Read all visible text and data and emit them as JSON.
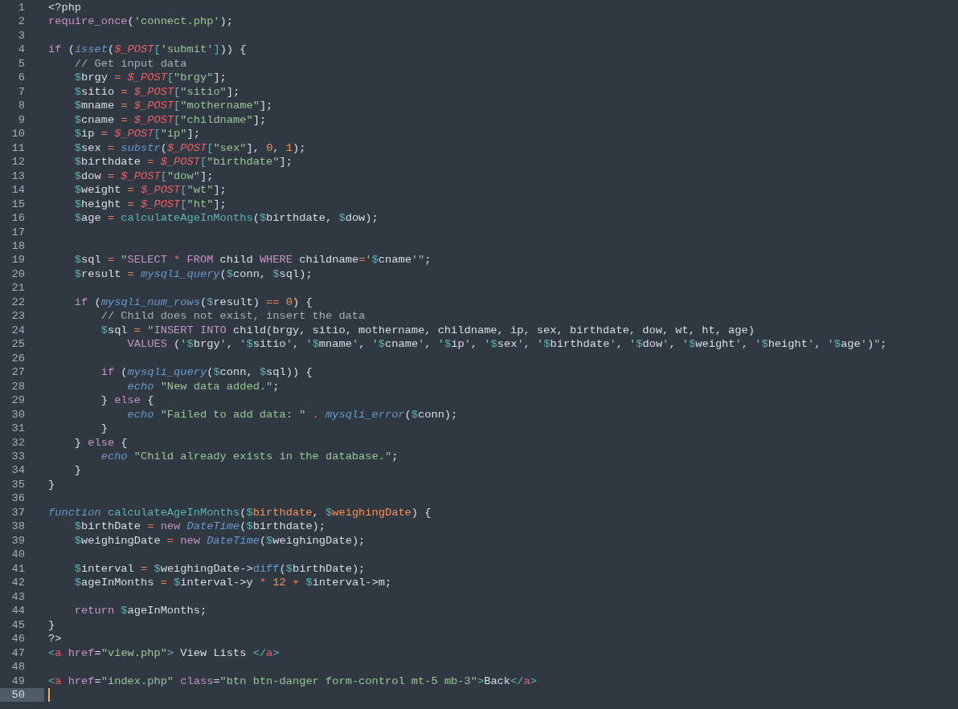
{
  "editor": {
    "lines": [
      {
        "number": "1",
        "current": false,
        "tokens": [
          {
            "text": "<?php",
            "kind": "plain"
          }
        ]
      },
      {
        "number": "2",
        "current": false,
        "tokens": [
          {
            "text": "require_once",
            "kind": "keyword"
          },
          {
            "text": "(",
            "kind": "plain"
          },
          {
            "text": "'connect.php'",
            "kind": "string"
          },
          {
            "text": ");",
            "kind": "plain"
          }
        ]
      },
      {
        "number": "3",
        "current": false
      },
      {
        "number": "4",
        "current": false,
        "tokens": [
          {
            "text": "if",
            "kind": "keyword"
          },
          {
            "text": " (",
            "kind": "plain"
          },
          {
            "text": "isset",
            "kind": "builtin"
          },
          {
            "text": "(",
            "kind": "plain"
          },
          {
            "text": "$_POST",
            "kind": "superglobal"
          },
          {
            "text": "[",
            "kind": "punct"
          },
          {
            "text": "'submit'",
            "kind": "string"
          },
          {
            "text": "]",
            "kind": "punct"
          },
          {
            "text": ")) {",
            "kind": "plain"
          }
        ]
      },
      {
        "number": "5",
        "current": false,
        "tokens": [
          {
            "text": "    // Get input data",
            "kind": "comment"
          }
        ]
      },
      {
        "number": "6",
        "current": false,
        "tokens": [
          {
            "text": "    $",
            "kind": "sigil"
          },
          {
            "text": "brgy ",
            "kind": "plain"
          },
          {
            "text": "=",
            "kind": "operator"
          },
          {
            "text": " $_POST",
            "kind": "superglobal"
          },
          {
            "text": "[",
            "kind": "punct"
          },
          {
            "text": "\"brgy\"",
            "kind": "string"
          },
          {
            "text": "];",
            "kind": "plain"
          }
        ]
      },
      {
        "number": "7",
        "current": false,
        "tokens": [
          {
            "text": "    $",
            "kind": "sigil"
          },
          {
            "text": "sitio ",
            "kind": "plain"
          },
          {
            "text": "=",
            "kind": "operator"
          },
          {
            "text": " $_POST",
            "kind": "superglobal"
          },
          {
            "text": "[",
            "kind": "punct"
          },
          {
            "text": "\"sitio\"",
            "kind": "string"
          },
          {
            "text": "];",
            "kind": "plain"
          }
        ]
      },
      {
        "number": "8",
        "current": false,
        "tokens": [
          {
            "text": "    $",
            "kind": "sigil"
          },
          {
            "text": "mname ",
            "kind": "plain"
          },
          {
            "text": "=",
            "kind": "operator"
          },
          {
            "text": " $_POST",
            "kind": "superglobal"
          },
          {
            "text": "[",
            "kind": "punct"
          },
          {
            "text": "\"mothername\"",
            "kind": "string"
          },
          {
            "text": "];",
            "kind": "plain"
          }
        ]
      },
      {
        "number": "9",
        "current": false,
        "tokens": [
          {
            "text": "    $",
            "kind": "sigil"
          },
          {
            "text": "cname ",
            "kind": "plain"
          },
          {
            "text": "=",
            "kind": "operator"
          },
          {
            "text": " $_POST",
            "kind": "superglobal"
          },
          {
            "text": "[",
            "kind": "punct"
          },
          {
            "text": "\"childname\"",
            "kind": "string"
          },
          {
            "text": "];",
            "kind": "plain"
          }
        ]
      },
      {
        "number": "10",
        "current": false,
        "tokens": [
          {
            "text": "    $",
            "kind": "sigil"
          },
          {
            "text": "ip ",
            "kind": "plain"
          },
          {
            "text": "=",
            "kind": "operator"
          },
          {
            "text": " $_POST",
            "kind": "superglobal"
          },
          {
            "text": "[",
            "kind": "punct"
          },
          {
            "text": "\"ip\"",
            "kind": "string"
          },
          {
            "text": "];",
            "kind": "plain"
          }
        ]
      },
      {
        "number": "11",
        "current": false,
        "tokens": [
          {
            "text": "    $",
            "kind": "sigil"
          },
          {
            "text": "sex ",
            "kind": "plain"
          },
          {
            "text": "=",
            "kind": "operator"
          },
          {
            "text": " substr",
            "kind": "builtin"
          },
          {
            "text": "(",
            "kind": "plain"
          },
          {
            "text": "$_POST",
            "kind": "superglobal"
          },
          {
            "text": "[",
            "kind": "punct"
          },
          {
            "text": "\"sex\"",
            "kind": "string"
          },
          {
            "text": "], ",
            "kind": "plain"
          },
          {
            "text": "0",
            "kind": "number"
          },
          {
            "text": ", ",
            "kind": "plain"
          },
          {
            "text": "1",
            "kind": "number"
          },
          {
            "text": ");",
            "kind": "plain"
          }
        ]
      },
      {
        "number": "12",
        "current": false,
        "tokens": [
          {
            "text": "    $",
            "kind": "sigil"
          },
          {
            "text": "birthdate ",
            "kind": "plain"
          },
          {
            "text": "=",
            "kind": "operator"
          },
          {
            "text": " $_POST",
            "kind": "superglobal"
          },
          {
            "text": "[",
            "kind": "punct"
          },
          {
            "text": "\"birthdate\"",
            "kind": "string"
          },
          {
            "text": "];",
            "kind": "plain"
          }
        ]
      },
      {
        "number": "13",
        "current": false,
        "tokens": [
          {
            "text": "    $",
            "kind": "sigil"
          },
          {
            "text": "dow ",
            "kind": "plain"
          },
          {
            "text": "=",
            "kind": "operator"
          },
          {
            "text": " $_POST",
            "kind": "superglobal"
          },
          {
            "text": "[",
            "kind": "punct"
          },
          {
            "text": "\"dow\"",
            "kind": "string"
          },
          {
            "text": "];",
            "kind": "plain"
          }
        ]
      },
      {
        "number": "14",
        "current": false,
        "tokens": [
          {
            "text": "    $",
            "kind": "sigil"
          },
          {
            "text": "weight ",
            "kind": "plain"
          },
          {
            "text": "=",
            "kind": "operator"
          },
          {
            "text": " $_POST",
            "kind": "superglobal"
          },
          {
            "text": "[",
            "kind": "punct"
          },
          {
            "text": "\"wt\"",
            "kind": "string"
          },
          {
            "text": "];",
            "kind": "plain"
          }
        ]
      },
      {
        "number": "15",
        "current": false,
        "tokens": [
          {
            "text": "    $",
            "kind": "sigil"
          },
          {
            "text": "height ",
            "kind": "plain"
          },
          {
            "text": "=",
            "kind": "operator"
          },
          {
            "text": " $_POST",
            "kind": "superglobal"
          },
          {
            "text": "[",
            "kind": "punct"
          },
          {
            "text": "\"ht\"",
            "kind": "string"
          },
          {
            "text": "];",
            "kind": "plain"
          }
        ]
      },
      {
        "number": "16",
        "current": false,
        "tokens": [
          {
            "text": "    $",
            "kind": "sigil"
          },
          {
            "text": "age ",
            "kind": "plain"
          },
          {
            "text": "=",
            "kind": "operator"
          },
          {
            "text": " calculateAgeInMonths",
            "kind": "function"
          },
          {
            "text": "(",
            "kind": "plain"
          },
          {
            "text": "$",
            "kind": "sigil"
          },
          {
            "text": "birthdate, ",
            "kind": "plain"
          },
          {
            "text": "$",
            "kind": "sigil"
          },
          {
            "text": "dow);",
            "kind": "plain"
          }
        ]
      },
      {
        "number": "17",
        "current": false
      },
      {
        "number": "18",
        "current": false
      },
      {
        "number": "19",
        "current": false,
        "tokens": [
          {
            "text": "    $",
            "kind": "sigil"
          },
          {
            "text": "sql ",
            "kind": "plain"
          },
          {
            "text": "=",
            "kind": "operator"
          },
          {
            "text": " \"",
            "kind": "string"
          },
          {
            "text": "SELECT",
            "kind": "keyword"
          },
          {
            "text": " *",
            "kind": "operator"
          },
          {
            "text": " FROM",
            "kind": "keyword"
          },
          {
            "text": " child ",
            "kind": "plain"
          },
          {
            "text": "WHERE",
            "kind": "keyword"
          },
          {
            "text": " childname",
            "kind": "plain"
          },
          {
            "text": "=",
            "kind": "operator"
          },
          {
            "text": "'",
            "kind": "string"
          },
          {
            "text": "$",
            "kind": "sigil"
          },
          {
            "text": "cname",
            "kind": "plain"
          },
          {
            "text": "'\"",
            "kind": "string"
          },
          {
            "text": ";",
            "kind": "plain"
          }
        ]
      },
      {
        "number": "20",
        "current": false,
        "tokens": [
          {
            "text": "    $",
            "kind": "sigil"
          },
          {
            "text": "result ",
            "kind": "plain"
          },
          {
            "text": "=",
            "kind": "operator"
          },
          {
            "text": " mysqli_query",
            "kind": "builtin"
          },
          {
            "text": "(",
            "kind": "plain"
          },
          {
            "text": "$",
            "kind": "sigil"
          },
          {
            "text": "conn, ",
            "kind": "plain"
          },
          {
            "text": "$",
            "kind": "sigil"
          },
          {
            "text": "sql);",
            "kind": "plain"
          }
        ]
      },
      {
        "number": "21",
        "current": false
      },
      {
        "number": "22",
        "current": false,
        "tokens": [
          {
            "text": "    if",
            "kind": "keyword"
          },
          {
            "text": " (",
            "kind": "plain"
          },
          {
            "text": "mysqli_num_rows",
            "kind": "builtin"
          },
          {
            "text": "(",
            "kind": "plain"
          },
          {
            "text": "$",
            "kind": "sigil"
          },
          {
            "text": "result) ",
            "kind": "plain"
          },
          {
            "text": "==",
            "kind": "operator"
          },
          {
            "text": " 0",
            "kind": "number"
          },
          {
            "text": ") {",
            "kind": "plain"
          }
        ]
      },
      {
        "number": "23",
        "current": false,
        "tokens": [
          {
            "text": "        // Child does not exist, insert the data",
            "kind": "comment"
          }
        ]
      },
      {
        "number": "24",
        "current": false,
        "tokens": [
          {
            "text": "        $",
            "kind": "sigil"
          },
          {
            "text": "sql ",
            "kind": "plain"
          },
          {
            "text": "=",
            "kind": "operator"
          },
          {
            "text": " \"",
            "kind": "string"
          },
          {
            "text": "INSERT INTO",
            "kind": "keyword"
          },
          {
            "text": " child(brgy, sitio, mothername, childname, ip, sex, birthdate, dow, wt, ht, age)",
            "kind": "plain"
          }
        ]
      },
      {
        "number": "25",
        "current": false,
        "tokens": [
          {
            "text": "            VALUES",
            "kind": "keyword"
          },
          {
            "text": " (",
            "kind": "plain"
          },
          {
            "text": "'",
            "kind": "string"
          },
          {
            "text": "$",
            "kind": "sigil"
          },
          {
            "text": "brgy",
            "kind": "plain"
          },
          {
            "text": "'",
            "kind": "string"
          },
          {
            "text": ", ",
            "kind": "plain"
          },
          {
            "text": "'",
            "kind": "string"
          },
          {
            "text": "$",
            "kind": "sigil"
          },
          {
            "text": "sitio",
            "kind": "plain"
          },
          {
            "text": "'",
            "kind": "string"
          },
          {
            "text": ", ",
            "kind": "plain"
          },
          {
            "text": "'",
            "kind": "string"
          },
          {
            "text": "$",
            "kind": "sigil"
          },
          {
            "text": "mname",
            "kind": "plain"
          },
          {
            "text": "'",
            "kind": "string"
          },
          {
            "text": ", ",
            "kind": "plain"
          },
          {
            "text": "'",
            "kind": "string"
          },
          {
            "text": "$",
            "kind": "sigil"
          },
          {
            "text": "cname",
            "kind": "plain"
          },
          {
            "text": "'",
            "kind": "string"
          },
          {
            "text": ", ",
            "kind": "plain"
          },
          {
            "text": "'",
            "kind": "string"
          },
          {
            "text": "$",
            "kind": "sigil"
          },
          {
            "text": "ip",
            "kind": "plain"
          },
          {
            "text": "'",
            "kind": "string"
          },
          {
            "text": ", ",
            "kind": "plain"
          },
          {
            "text": "'",
            "kind": "string"
          },
          {
            "text": "$",
            "kind": "sigil"
          },
          {
            "text": "sex",
            "kind": "plain"
          },
          {
            "text": "'",
            "kind": "string"
          },
          {
            "text": ", ",
            "kind": "plain"
          },
          {
            "text": "'",
            "kind": "string"
          },
          {
            "text": "$",
            "kind": "sigil"
          },
          {
            "text": "birthdate",
            "kind": "plain"
          },
          {
            "text": "'",
            "kind": "string"
          },
          {
            "text": ", ",
            "kind": "plain"
          },
          {
            "text": "'",
            "kind": "string"
          },
          {
            "text": "$",
            "kind": "sigil"
          },
          {
            "text": "dow",
            "kind": "plain"
          },
          {
            "text": "'",
            "kind": "string"
          },
          {
            "text": ", ",
            "kind": "plain"
          },
          {
            "text": "'",
            "kind": "string"
          },
          {
            "text": "$",
            "kind": "sigil"
          },
          {
            "text": "weight",
            "kind": "plain"
          },
          {
            "text": "'",
            "kind": "string"
          },
          {
            "text": ", ",
            "kind": "plain"
          },
          {
            "text": "'",
            "kind": "string"
          },
          {
            "text": "$",
            "kind": "sigil"
          },
          {
            "text": "height",
            "kind": "plain"
          },
          {
            "text": "'",
            "kind": "string"
          },
          {
            "text": ", ",
            "kind": "plain"
          },
          {
            "text": "'",
            "kind": "string"
          },
          {
            "text": "$",
            "kind": "sigil"
          },
          {
            "text": "age",
            "kind": "plain"
          },
          {
            "text": "'",
            "kind": "string"
          },
          {
            "text": ")",
            "kind": "plain"
          },
          {
            "text": "\"",
            "kind": "string"
          },
          {
            "text": ";",
            "kind": "plain"
          }
        ]
      },
      {
        "number": "26",
        "current": false
      },
      {
        "number": "27",
        "current": false,
        "tokens": [
          {
            "text": "        if",
            "kind": "keyword"
          },
          {
            "text": " (",
            "kind": "plain"
          },
          {
            "text": "mysqli_query",
            "kind": "builtin"
          },
          {
            "text": "(",
            "kind": "plain"
          },
          {
            "text": "$",
            "kind": "sigil"
          },
          {
            "text": "conn, ",
            "kind": "plain"
          },
          {
            "text": "$",
            "kind": "sigil"
          },
          {
            "text": "sql)) {",
            "kind": "plain"
          }
        ]
      },
      {
        "number": "28",
        "current": false,
        "tokens": [
          {
            "text": "            echo",
            "kind": "builtin"
          },
          {
            "text": " \"New data added.\"",
            "kind": "string"
          },
          {
            "text": ";",
            "kind": "plain"
          }
        ]
      },
      {
        "number": "29",
        "current": false,
        "tokens": [
          {
            "text": "        } ",
            "kind": "plain"
          },
          {
            "text": "else",
            "kind": "keyword"
          },
          {
            "text": " {",
            "kind": "plain"
          }
        ]
      },
      {
        "number": "30",
        "current": false,
        "tokens": [
          {
            "text": "            echo",
            "kind": "builtin"
          },
          {
            "text": " \"Failed to add data: \"",
            "kind": "string"
          },
          {
            "text": " .",
            "kind": "operator"
          },
          {
            "text": " mysqli_error",
            "kind": "builtin"
          },
          {
            "text": "(",
            "kind": "plain"
          },
          {
            "text": "$",
            "kind": "sigil"
          },
          {
            "text": "conn);",
            "kind": "plain"
          }
        ]
      },
      {
        "number": "31",
        "current": false,
        "tokens": [
          {
            "text": "        }",
            "kind": "plain"
          }
        ]
      },
      {
        "number": "32",
        "current": false,
        "tokens": [
          {
            "text": "    } ",
            "kind": "plain"
          },
          {
            "text": "else",
            "kind": "keyword"
          },
          {
            "text": " {",
            "kind": "plain"
          }
        ]
      },
      {
        "number": "33",
        "current": false,
        "tokens": [
          {
            "text": "        echo",
            "kind": "builtin"
          },
          {
            "text": " \"Child already exists in the database.\"",
            "kind": "string"
          },
          {
            "text": ";",
            "kind": "plain"
          }
        ]
      },
      {
        "number": "34",
        "current": false,
        "tokens": [
          {
            "text": "    }",
            "kind": "plain"
          }
        ]
      },
      {
        "number": "35",
        "current": false,
        "tokens": [
          {
            "text": "}",
            "kind": "plain"
          }
        ]
      },
      {
        "number": "36",
        "current": false
      },
      {
        "number": "37",
        "current": false,
        "tokens": [
          {
            "text": "function",
            "kind": "builtin"
          },
          {
            "text": " calculateAgeInMonths",
            "kind": "function"
          },
          {
            "text": "(",
            "kind": "plain"
          },
          {
            "text": "$",
            "kind": "sigil"
          },
          {
            "text": "birthdate",
            "kind": "param"
          },
          {
            "text": ", ",
            "kind": "plain"
          },
          {
            "text": "$",
            "kind": "sigil"
          },
          {
            "text": "weighingDate",
            "kind": "param"
          },
          {
            "text": ") {",
            "kind": "plain"
          }
        ]
      },
      {
        "number": "38",
        "current": false,
        "tokens": [
          {
            "text": "    $",
            "kind": "sigil"
          },
          {
            "text": "birthDate ",
            "kind": "plain"
          },
          {
            "text": "=",
            "kind": "operator"
          },
          {
            "text": " new",
            "kind": "keyword"
          },
          {
            "text": " DateTime",
            "kind": "builtin"
          },
          {
            "text": "(",
            "kind": "plain"
          },
          {
            "text": "$",
            "kind": "sigil"
          },
          {
            "text": "birthdate);",
            "kind": "plain"
          }
        ]
      },
      {
        "number": "39",
        "current": false,
        "tokens": [
          {
            "text": "    $",
            "kind": "sigil"
          },
          {
            "text": "weighingDate ",
            "kind": "plain"
          },
          {
            "text": "=",
            "kind": "operator"
          },
          {
            "text": " new",
            "kind": "keyword"
          },
          {
            "text": " DateTime",
            "kind": "builtin"
          },
          {
            "text": "(",
            "kind": "plain"
          },
          {
            "text": "$",
            "kind": "sigil"
          },
          {
            "text": "weighingDate);",
            "kind": "plain"
          }
        ]
      },
      {
        "number": "40",
        "current": false
      },
      {
        "number": "41",
        "current": false,
        "tokens": [
          {
            "text": "    $",
            "kind": "sigil"
          },
          {
            "text": "interval ",
            "kind": "plain"
          },
          {
            "text": "=",
            "kind": "operator"
          },
          {
            "text": " $",
            "kind": "sigil"
          },
          {
            "text": "weighingDate->",
            "kind": "plain"
          },
          {
            "text": "diff",
            "kind": "method"
          },
          {
            "text": "(",
            "kind": "plain"
          },
          {
            "text": "$",
            "kind": "sigil"
          },
          {
            "text": "birthDate);",
            "kind": "plain"
          }
        ]
      },
      {
        "number": "42",
        "current": false,
        "tokens": [
          {
            "text": "    $",
            "kind": "sigil"
          },
          {
            "text": "ageInMonths ",
            "kind": "plain"
          },
          {
            "text": "=",
            "kind": "operator"
          },
          {
            "text": " $",
            "kind": "sigil"
          },
          {
            "text": "interval->y ",
            "kind": "plain"
          },
          {
            "text": "*",
            "kind": "operator"
          },
          {
            "text": " 12",
            "kind": "number"
          },
          {
            "text": " +",
            "kind": "operator"
          },
          {
            "text": " $",
            "kind": "sigil"
          },
          {
            "text": "interval->m;",
            "kind": "plain"
          }
        ]
      },
      {
        "number": "43",
        "current": false
      },
      {
        "number": "44",
        "current": false,
        "tokens": [
          {
            "text": "    return",
            "kind": "keyword"
          },
          {
            "text": " $",
            "kind": "sigil"
          },
          {
            "text": "ageInMonths;",
            "kind": "plain"
          }
        ]
      },
      {
        "number": "45",
        "current": false,
        "tokens": [
          {
            "text": "}",
            "kind": "plain"
          }
        ]
      },
      {
        "number": "46",
        "current": false,
        "tokens": [
          {
            "text": "?>",
            "kind": "plain"
          }
        ]
      },
      {
        "number": "47",
        "current": false,
        "tokens": [
          {
            "text": "<",
            "kind": "punct"
          },
          {
            "text": "a",
            "kind": "tag"
          },
          {
            "text": " href",
            "kind": "attribute"
          },
          {
            "text": "=",
            "kind": "plain"
          },
          {
            "text": "\"view.php\"",
            "kind": "string"
          },
          {
            "text": ">",
            "kind": "punct"
          },
          {
            "text": " View Lists ",
            "kind": "plain"
          },
          {
            "text": "</",
            "kind": "punct"
          },
          {
            "text": "a",
            "kind": "tag"
          },
          {
            "text": ">",
            "kind": "punct"
          }
        ]
      },
      {
        "number": "48",
        "current": false
      },
      {
        "number": "49",
        "current": false,
        "tokens": [
          {
            "text": "<",
            "kind": "punct"
          },
          {
            "text": "a",
            "kind": "tag"
          },
          {
            "text": " href",
            "kind": "attribute"
          },
          {
            "text": "=",
            "kind": "plain"
          },
          {
            "text": "\"index.php\"",
            "kind": "string"
          },
          {
            "text": " class",
            "kind": "attribute"
          },
          {
            "text": "=",
            "kind": "plain"
          },
          {
            "text": "\"btn btn-danger form-control mt-5 mb-3\"",
            "kind": "string"
          },
          {
            "text": ">",
            "kind": "punct"
          },
          {
            "text": "Back",
            "kind": "plain"
          },
          {
            "text": "</",
            "kind": "punct"
          },
          {
            "text": "a",
            "kind": "tag"
          },
          {
            "text": ">",
            "kind": "punct"
          }
        ]
      },
      {
        "number": "50",
        "current": true
      }
    ]
  }
}
